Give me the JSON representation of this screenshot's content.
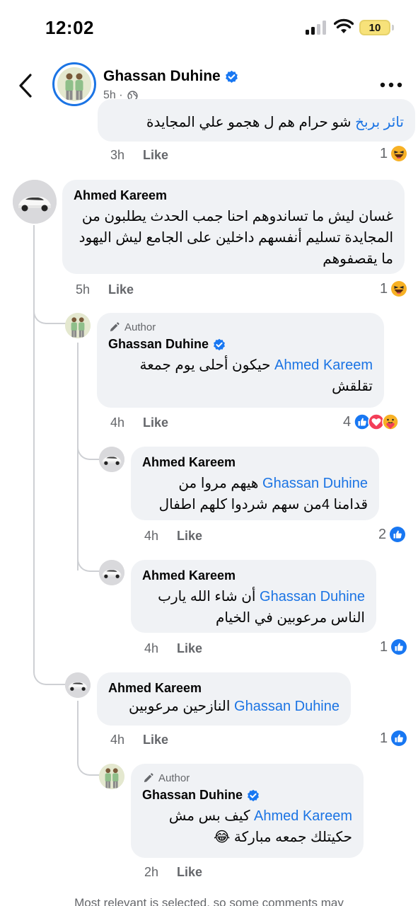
{
  "status_bar": {
    "time": "12:02",
    "battery": "10"
  },
  "header": {
    "name": "Ghassan Duhine",
    "meta": "5h ·"
  },
  "comments": [
    {
      "text_mention": "تائر بربخ",
      "text": "شو حرام هم ل هجمو علي المجايدة",
      "time": "3h",
      "like": "Like",
      "reaction_count": "1"
    },
    {
      "name": "Ahmed Kareem",
      "text": "غسان ليش ما تساندوهم احنا جمب الحدث يطلبون من المجايدة تسليم أنفسهم داخلين على الجامع ليش اليهود ما يقصفوهم",
      "time": "5h",
      "like": "Like",
      "reaction_count": "1"
    },
    {
      "author_label": "Author",
      "name": "Ghassan Duhine",
      "mention": "Ahmed Kareem",
      "text": "حيكون أحلى يوم جمعة تقلقش",
      "time": "4h",
      "like": "Like",
      "reaction_count": "4"
    },
    {
      "name": "Ahmed Kareem",
      "mention": "Ghassan Duhine",
      "text": "هيهم مروا من قدامنا 4من سهم شردوا كلهم اطفال",
      "time": "4h",
      "like": "Like",
      "reaction_count": "2"
    },
    {
      "name": "Ahmed Kareem",
      "mention": "Ghassan Duhine",
      "text": "أن شاء الله يارب الناس مرعوبين في الخيام",
      "time": "4h",
      "like": "Like",
      "reaction_count": "1"
    },
    {
      "name": "Ahmed Kareem",
      "mention": "Ghassan Duhine",
      "text": "النازحين مرعوبين",
      "time": "4h",
      "like": "Like",
      "reaction_count": "1"
    },
    {
      "author_label": "Author",
      "name": "Ghassan Duhine",
      "mention": "Ahmed Kareem",
      "text": "كيف بس مش حكيتلك جمعه مباركة 😂",
      "time": "2h",
      "like": "Like"
    }
  ],
  "footer": "Most relevant is selected, so some comments may",
  "colors": {
    "link": "#1b74e4",
    "bubble": "#f0f2f5",
    "secondary_text": "#65676b",
    "like_blue": "#1877f2",
    "love_red": "#f33e58"
  }
}
